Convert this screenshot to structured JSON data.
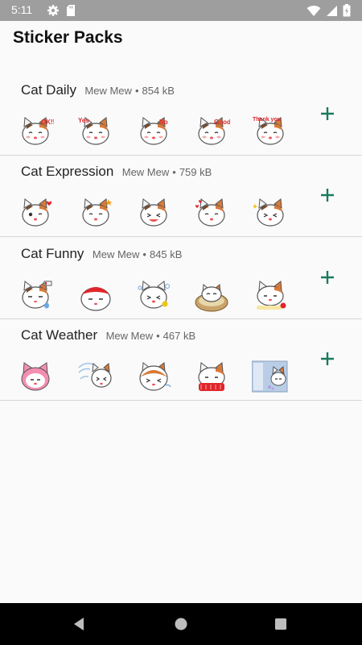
{
  "status_bar": {
    "time": "5:11",
    "left_icons": [
      "settings-icon",
      "sd-card-icon"
    ],
    "right_icons": [
      "wifi-icon",
      "cell-signal-icon",
      "battery-icon"
    ]
  },
  "app_bar": {
    "title": "Sticker Packs"
  },
  "packs": [
    {
      "name": "Cat Daily",
      "author": "Mew Mew",
      "size": "854 kB",
      "stickers": [
        {
          "caption": "OK!!"
        },
        {
          "caption": "Yes"
        },
        {
          "caption": "No"
        },
        {
          "caption": "Good"
        },
        {
          "caption": "Thank you"
        }
      ]
    },
    {
      "name": "Cat Expression",
      "author": "Mew Mew",
      "size": "759 kB",
      "stickers": [
        {
          "caption": ""
        },
        {
          "caption": ""
        },
        {
          "caption": ""
        },
        {
          "caption": ""
        },
        {
          "caption": ""
        }
      ]
    },
    {
      "name": "Cat Funny",
      "author": "Mew Mew",
      "size": "845 kB",
      "stickers": [
        {
          "caption": ""
        },
        {
          "caption": ""
        },
        {
          "caption": ""
        },
        {
          "caption": ""
        },
        {
          "caption": ""
        }
      ]
    },
    {
      "name": "Cat Weather",
      "author": "Mew Mew",
      "size": "467 kB",
      "stickers": [
        {
          "caption": ""
        },
        {
          "caption": ""
        },
        {
          "caption": ""
        },
        {
          "caption": ""
        },
        {
          "caption": ""
        }
      ]
    }
  ],
  "add_icon": "plus-icon",
  "nav_bar": {
    "buttons": [
      "back-icon",
      "home-icon",
      "recents-icon"
    ]
  },
  "colors": {
    "status_bar": "#9e9e9e",
    "background": "#fafafa",
    "accent": "#1b7a5e",
    "divider": "#d6d6d6",
    "nav_bar": "#000000"
  }
}
